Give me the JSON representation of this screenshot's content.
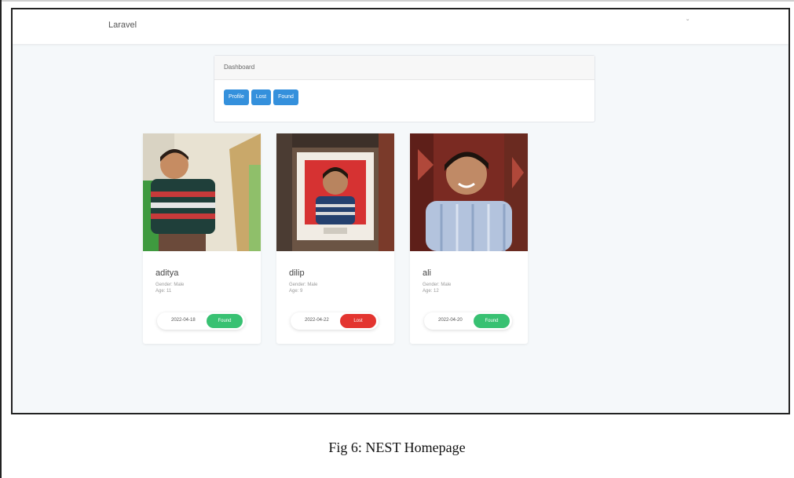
{
  "navbar": {
    "brand": "Laravel",
    "toggle": "ˇ"
  },
  "dashboard": {
    "header": "Dashboard",
    "buttons": [
      "Profile",
      "Lost",
      "Found"
    ]
  },
  "cards": [
    {
      "name": "aditya",
      "gender": "Gender: Male",
      "age": "Age: 11",
      "date": "2022-04-18",
      "status": "Found",
      "status_color": "#38c172"
    },
    {
      "name": "dilip",
      "gender": "Gender: Male",
      "age": "Age: 9",
      "date": "2022-04-22",
      "status": "Lost",
      "status_color": "#e3342f"
    },
    {
      "name": "ali",
      "gender": "Gender: Male",
      "age": "Age: 12",
      "date": "2022-04-20",
      "status": "Found",
      "status_color": "#38c172"
    }
  ],
  "caption": "Fig 6: NEST Homepage",
  "colors": {
    "primary": "#3490dc",
    "success": "#38c172",
    "danger": "#e3342f",
    "background": "#f5f8fa"
  }
}
